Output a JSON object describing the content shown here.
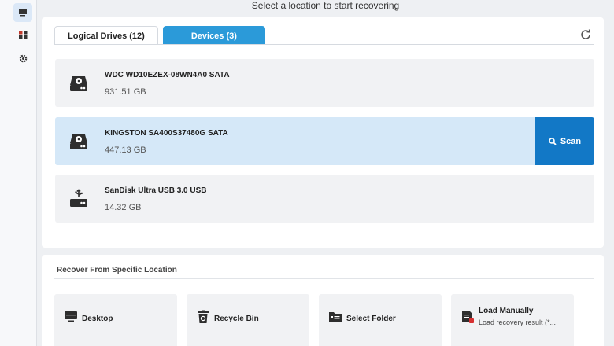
{
  "header": {
    "title": "Select a location to start recovering"
  },
  "tabs": [
    {
      "label": "Logical Drives (12)",
      "active": false
    },
    {
      "label": "Devices (3)",
      "active": true
    }
  ],
  "drives": [
    {
      "name": "WDC WD10EZEX-08WN4A0 SATA",
      "size": "931.51 GB",
      "icon": "hard-drive-icon"
    },
    {
      "name": "KINGSTON SA400S37480G SATA",
      "size": "447.13 GB",
      "icon": "hard-drive-icon",
      "selected": true
    },
    {
      "name": "SanDisk Ultra USB 3.0 USB",
      "size": "14.32 GB",
      "icon": "usb-drive-icon"
    }
  ],
  "scan_button": {
    "label": "Scan"
  },
  "specific": {
    "title": "Recover From Specific Location",
    "items": [
      {
        "label": "Desktop",
        "icon": "desktop-icon"
      },
      {
        "label": "Recycle Bin",
        "icon": "recycle-bin-icon"
      },
      {
        "label": "Select Folder",
        "icon": "folder-icon"
      },
      {
        "label": "Load Manually",
        "sublabel": "Load recovery result (*...",
        "icon": "load-manually-icon"
      }
    ]
  },
  "colors": {
    "accent": "#2b9ad9",
    "scan": "#1278c6",
    "selected_row": "#d5e8f8"
  }
}
